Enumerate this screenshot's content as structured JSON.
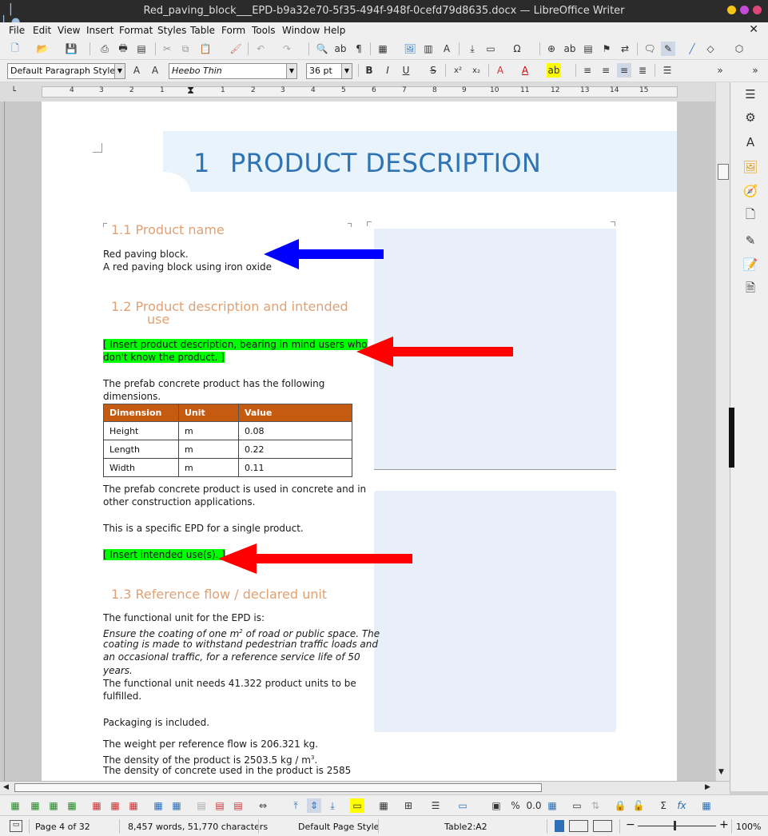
{
  "window": {
    "title": "Red_paving_block___EPD-b9a32e70-5f35-494f-948f-0cefd79d8635.docx — LibreOffice Writer"
  },
  "menu": [
    "File",
    "Edit",
    "View",
    "Insert",
    "Format",
    "Styles",
    "Table",
    "Form",
    "Tools",
    "Window",
    "Help"
  ],
  "formatting": {
    "paragraph_style": "Default Paragraph Style",
    "font_name": "Heebo Thin",
    "font_size": "36 pt"
  },
  "ruler_numbers": [
    "4",
    "3",
    "2",
    "1",
    "1",
    "2",
    "3",
    "4",
    "5",
    "6",
    "7",
    "8",
    "9",
    "10",
    "11",
    "12",
    "13",
    "14",
    "15"
  ],
  "document": {
    "h1_number": "1",
    "h1_text": "PRODUCT DESCRIPTION",
    "s11_heading": "1.1   Product name",
    "product_line1": "Red paving block.",
    "product_line2": "A red paving block using iron oxide",
    "s12_heading_line1": "1.2   Product description and intended",
    "s12_heading_line2": "use",
    "placeholder_desc_line1": "[ Insert product description, bearing in mind users who",
    "placeholder_desc_line2": "don't know the product. ]",
    "dims_intro_line1": "The prefab concrete product has the following",
    "dims_intro_line2": "dimensions.",
    "table": {
      "headers": [
        "Dimension",
        "Unit",
        "Value"
      ],
      "rows": [
        [
          "Height",
          "m",
          "0.08"
        ],
        [
          "Length",
          "m",
          "0.22"
        ],
        [
          "Width",
          "m",
          "0.11"
        ]
      ]
    },
    "used_line1": "The prefab concrete product is used in concrete and in",
    "used_line2": "other construction applications.",
    "specific_epd": "This is a specific EPD for a single product.",
    "placeholder_use": "[ Insert intended use(s). ]",
    "s13_heading": "1.3   Reference flow / declared unit",
    "fu_intro": "The functional unit for the EPD is:",
    "fu_italic_1a": "Ensure the coating of one m",
    "fu_italic_sup": "2",
    "fu_italic_1b": " of road or public space. The",
    "fu_italic_2": "coating is made to withstand pedestrian traffic loads and",
    "fu_italic_3": "an occasional traffic, for a reference service life of 50",
    "fu_italic_4": "years.",
    "fu_need_1": "The functional unit needs 41.322 product units to be",
    "fu_need_2": "fulfilled.",
    "packaging": "Packaging is included.",
    "weight": "The weight per reference flow is 206.321 kg.",
    "density_a": "The density of the product is 2503.5 kg / m",
    "density_sup": "3",
    "density_b": ".",
    "density_concrete": "The density of concrete used in the product is 2585"
  },
  "status": {
    "page": "Page 4 of 32",
    "words": "8,457 words, 51,770 characters",
    "page_style": "Default Page Style",
    "cell": "Table2:A2",
    "zoom": "100%"
  },
  "colors": {
    "heading1": "#2e74b5",
    "heading2": "#e0a172",
    "table_header": "#c55a11",
    "highlight": "#00ff00",
    "arrow_blue": "#0000ff",
    "arrow_red": "#ff0000"
  }
}
